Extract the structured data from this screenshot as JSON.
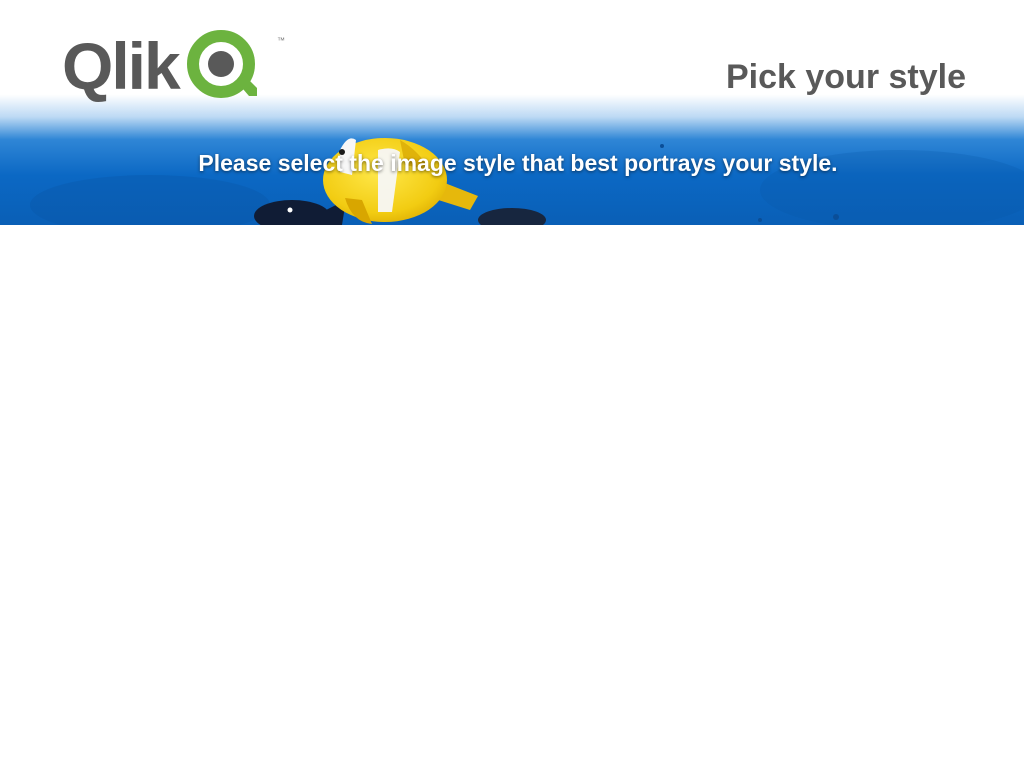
{
  "brand": {
    "name": "Qlik",
    "trademark": "™",
    "text_color": "#595959",
    "accent_color": "#6CB33F"
  },
  "header": {
    "title": "Pick your style",
    "subtitle": "Please select the image style that best portrays your style."
  },
  "banner": {
    "image": "underwater-clownfish-photo",
    "water_color": "#0A6BC8"
  }
}
